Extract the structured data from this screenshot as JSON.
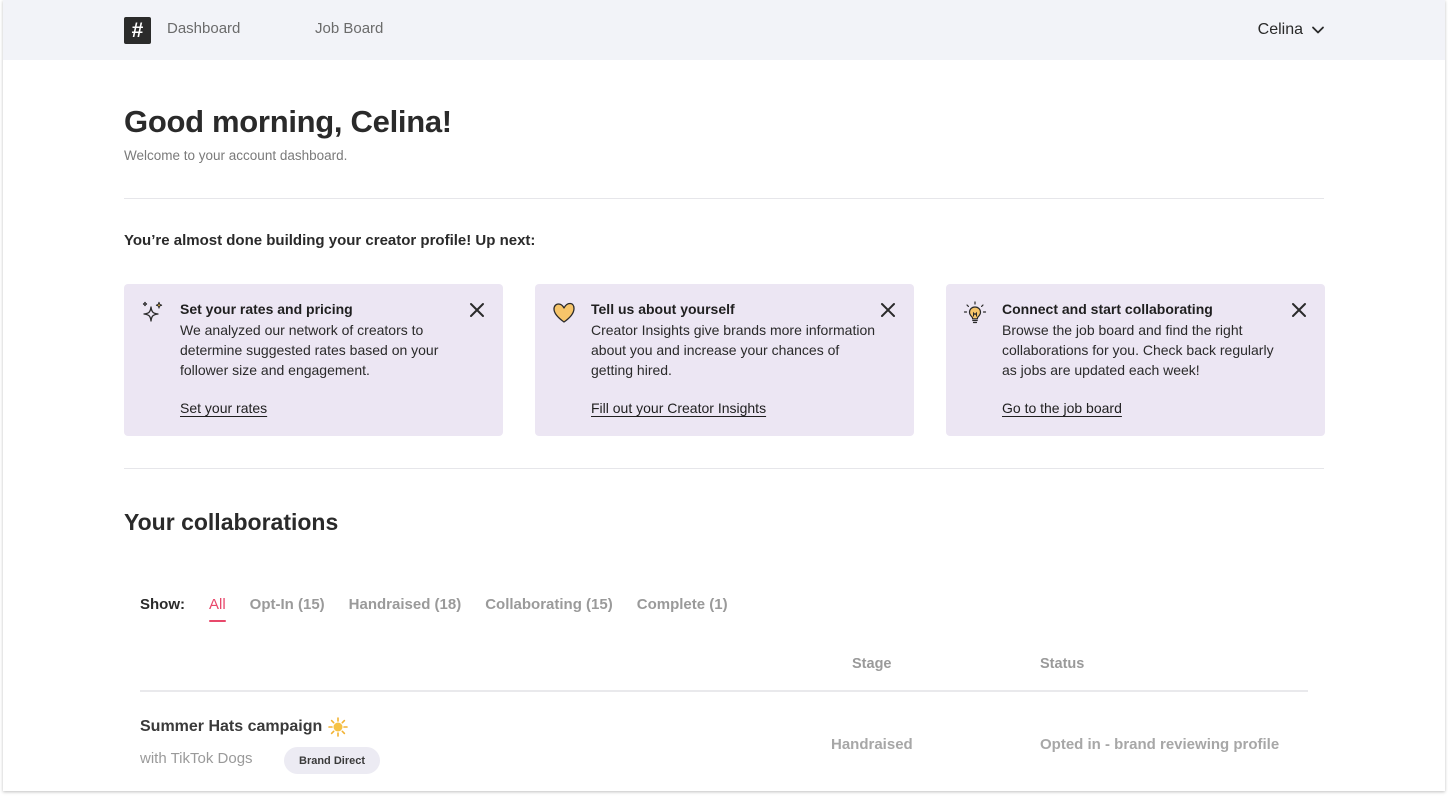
{
  "nav": {
    "logo_glyph": "#",
    "links": [
      "Dashboard",
      "Job Board"
    ],
    "user_name": "Celina"
  },
  "header": {
    "greeting": "Good morning, Celina!",
    "subtitle": "Welcome to your account dashboard."
  },
  "profile": {
    "heading": "You’re almost done building your creator profile! Up next:",
    "cards": [
      {
        "icon": "sparkle-icon",
        "title": "Set your rates and pricing",
        "body": "We analyzed our network of creators to determine suggested rates based on your follower size and engagement.",
        "link": "Set your rates"
      },
      {
        "icon": "heart-icon",
        "title": "Tell us about yourself",
        "body": "Creator Insights give brands more information about you and increase your chances of getting hired.",
        "link": "Fill out your Creator Insights"
      },
      {
        "icon": "lightbulb-icon",
        "title": "Connect and start collaborating",
        "body": "Browse the job board and find the right collaborations for you. Check back regularly as jobs are updated each week!",
        "link": "Go to the job board"
      }
    ]
  },
  "collaborations": {
    "title": "Your collaborations",
    "show_label": "Show:",
    "filters": [
      "All",
      "Opt-In (15)",
      "Handraised (18)",
      "Collaborating (15)",
      "Complete (1)"
    ],
    "active_filter": "All",
    "columns": {
      "stage": "Stage",
      "status": "Status"
    },
    "rows": [
      {
        "title": "Summer Hats campaign",
        "brand": "with TikTok Dogs",
        "badge": "Brand Direct",
        "stage": "Handraised",
        "status": "Opted in - brand reviewing profile"
      }
    ]
  },
  "colors": {
    "accent": "#e8486b",
    "card_bg": "#ece6f3",
    "topbar_bg": "#f2f3f8"
  }
}
